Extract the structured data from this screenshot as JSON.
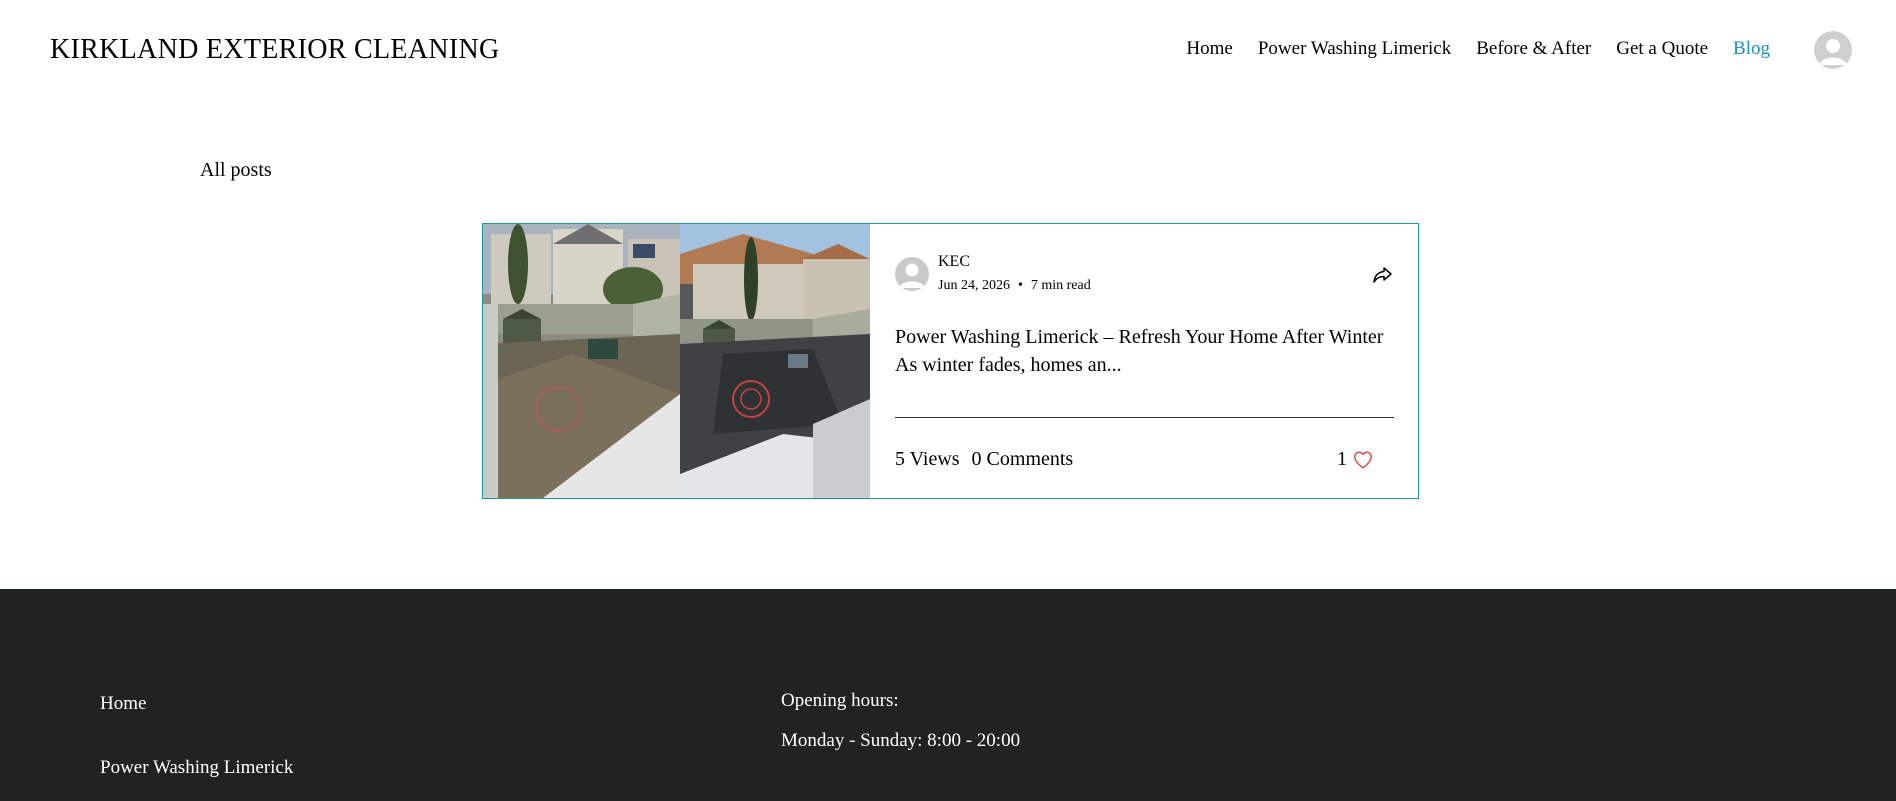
{
  "header": {
    "site_title": "KIRKLAND EXTERIOR CLEANING",
    "nav": [
      {
        "label": "Home"
      },
      {
        "label": "Power Washing Limerick"
      },
      {
        "label": "Before & After"
      },
      {
        "label": "Get a Quote"
      },
      {
        "label": "Blog",
        "active": true
      }
    ],
    "account_icon": "user-avatar-icon"
  },
  "blog": {
    "all_posts_label": "All posts",
    "post": {
      "author": "KEC",
      "date": "Jun 24, 2026",
      "separator": "•",
      "read_time": "7 min read",
      "title": "Power Washing Limerick – Refresh Your Home After Winter",
      "excerpt": "As winter fades, homes an...",
      "views": "5 Views",
      "comments": "0 Comments",
      "likes": "1",
      "share_icon": "share-icon",
      "like_icon": "heart-icon",
      "image_description": "before-and-after-patio-cleaning-photo"
    }
  },
  "footer": {
    "links": [
      {
        "label": "Home"
      },
      {
        "label": "Power Washing Limerick"
      }
    ],
    "hours_title": "Opening hours:",
    "hours_value": "Monday - Sunday: 8:00 - 20:00"
  },
  "colors": {
    "accent": "#1a8fc0",
    "card_border": "#1b9aa4",
    "footer_bg": "#1f2421",
    "heart": "#e04a4a"
  }
}
